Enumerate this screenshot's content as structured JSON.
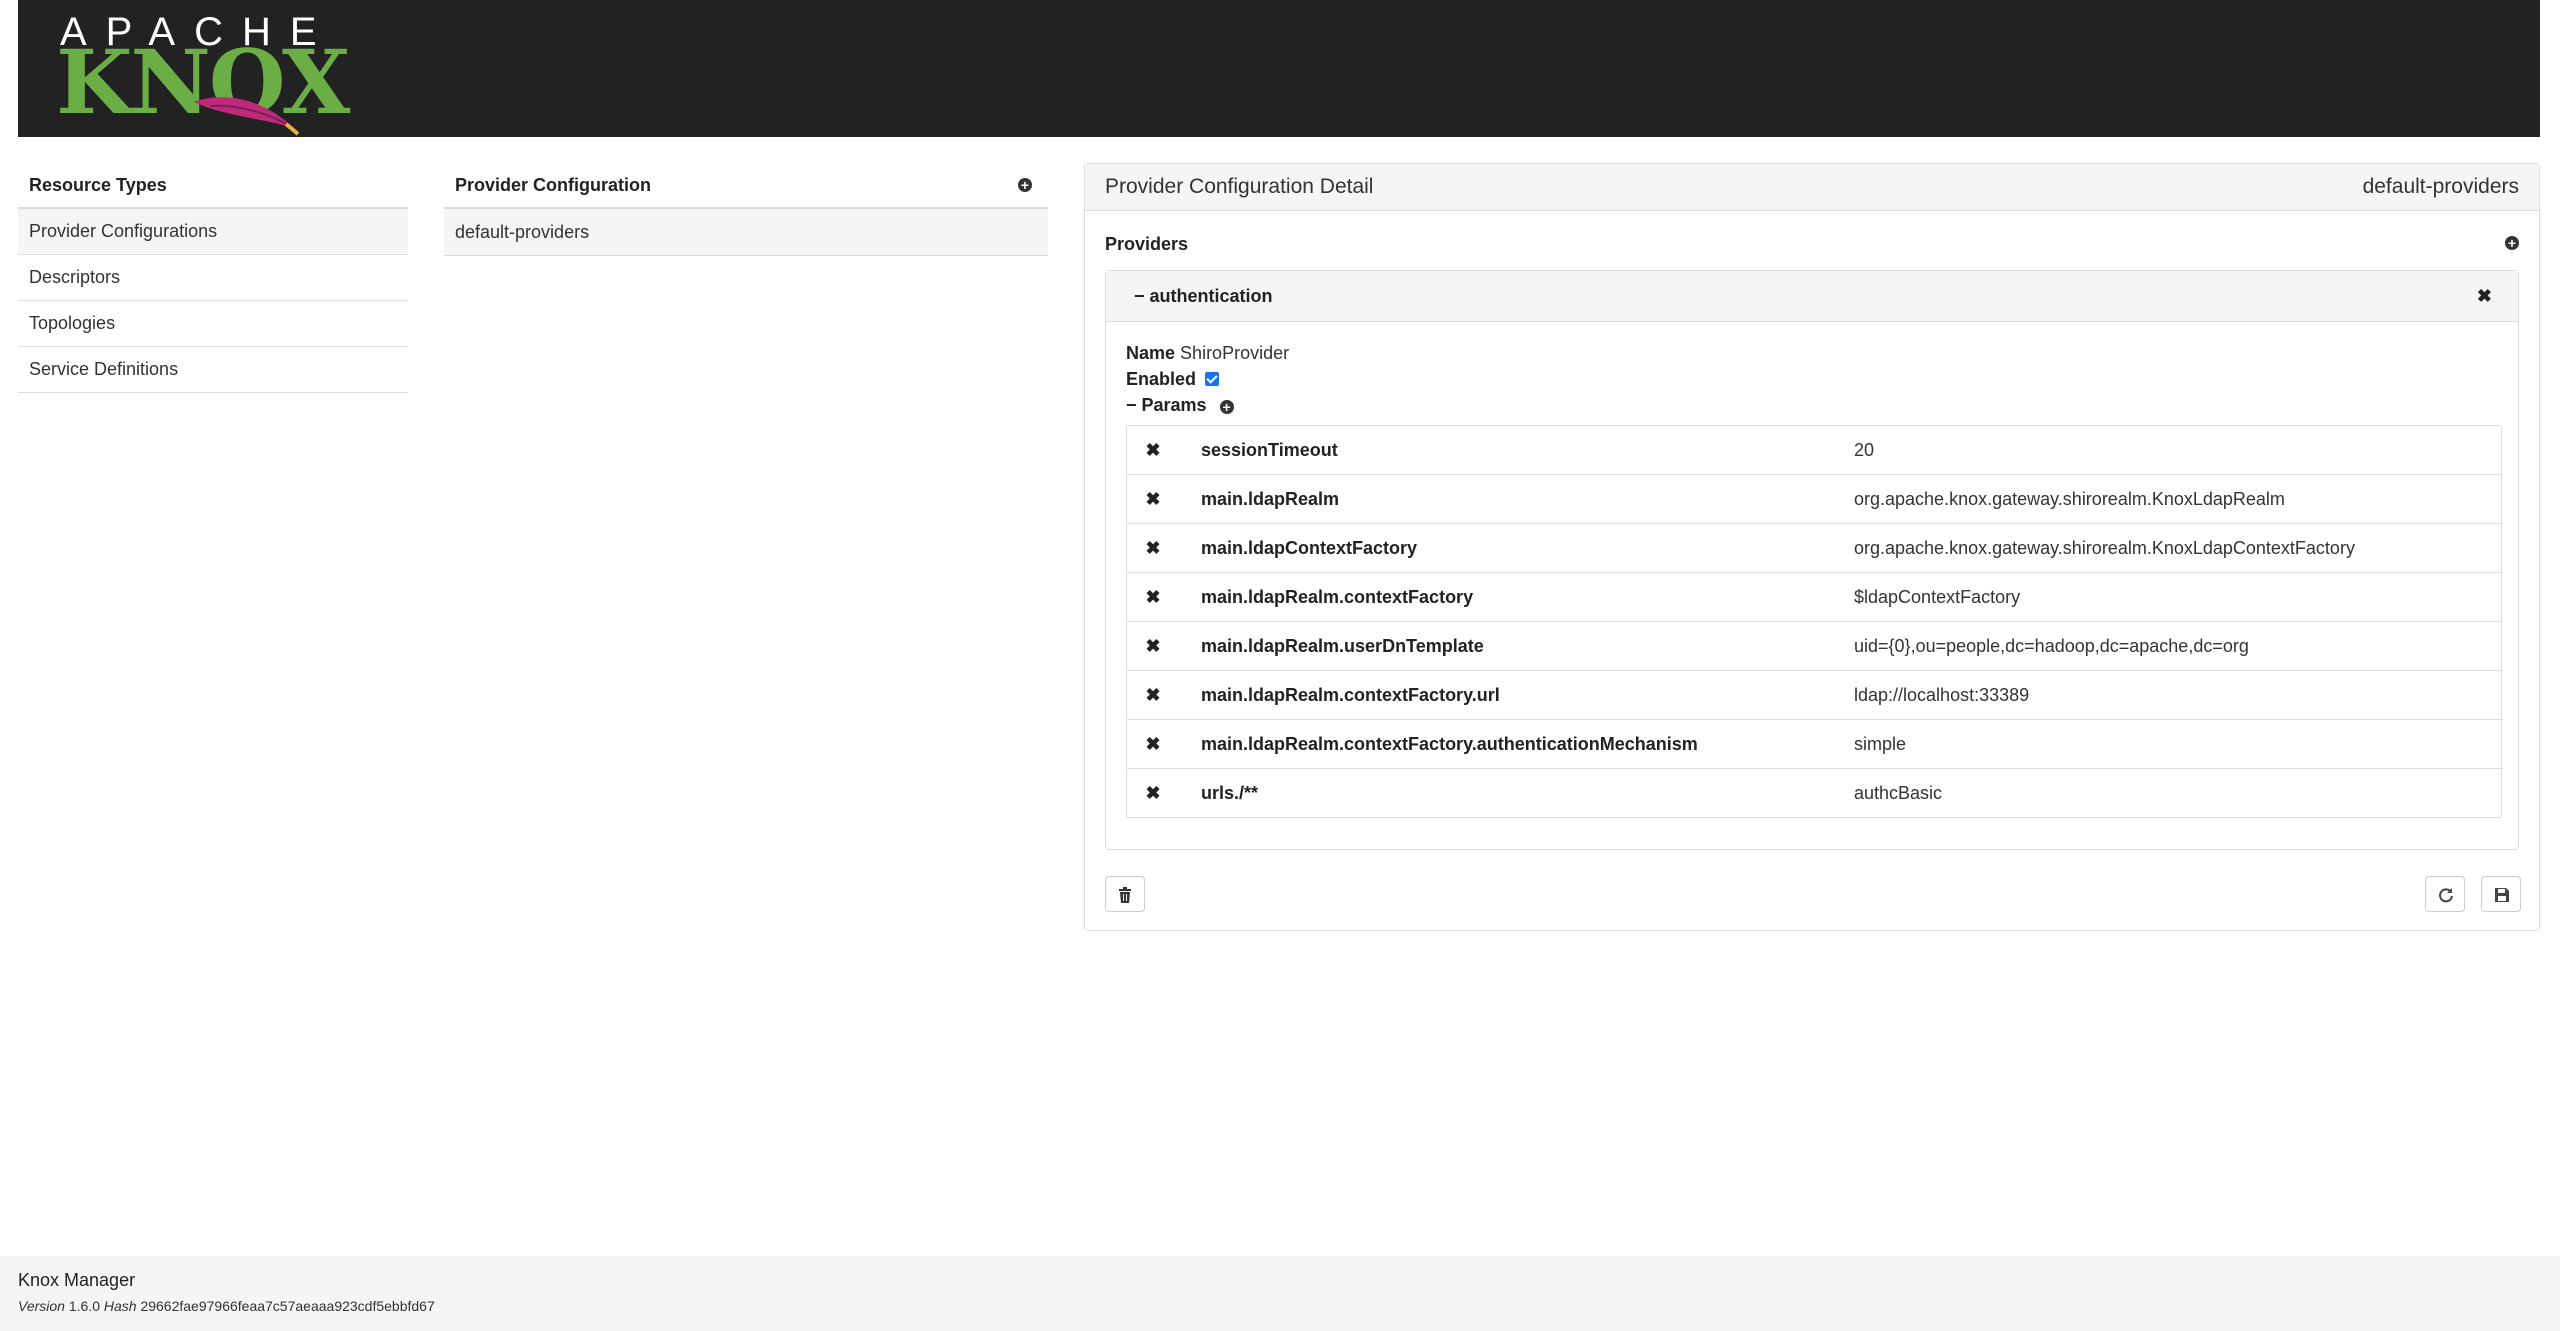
{
  "header": {
    "logo_apache": "APACHE",
    "logo_knox": "KNOX"
  },
  "sidebar": {
    "title": "Resource Types",
    "items": [
      {
        "label": "Provider Configurations",
        "active": true
      },
      {
        "label": "Descriptors"
      },
      {
        "label": "Topologies"
      },
      {
        "label": "Service Definitions"
      }
    ]
  },
  "provider_list": {
    "title": "Provider Configuration",
    "items": [
      "default-providers"
    ]
  },
  "detail": {
    "title": "Provider Configuration Detail",
    "name": "default-providers",
    "providers_label": "Providers",
    "provider": {
      "role": "− authentication",
      "name_label": "Name",
      "name_value": "ShiroProvider",
      "enabled_label": "Enabled",
      "enabled": true,
      "params_label": "− Params",
      "params": [
        {
          "key": "sessionTimeout",
          "value": "20"
        },
        {
          "key": "main.ldapRealm",
          "value": "org.apache.knox.gateway.shirorealm.KnoxLdapRealm"
        },
        {
          "key": "main.ldapContextFactory",
          "value": "org.apache.knox.gateway.shirorealm.KnoxLdapContextFactory"
        },
        {
          "key": "main.ldapRealm.contextFactory",
          "value": "$ldapContextFactory"
        },
        {
          "key": "main.ldapRealm.userDnTemplate",
          "value": "uid={0},ou=people,dc=hadoop,dc=apache,dc=org"
        },
        {
          "key": "main.ldapRealm.contextFactory.url",
          "value": "ldap://localhost:33389"
        },
        {
          "key": "main.ldapRealm.contextFactory.authenticationMechanism",
          "value": "simple"
        },
        {
          "key": "urls./**",
          "value": "authcBasic"
        }
      ]
    }
  },
  "footer": {
    "title": "Knox Manager",
    "version_label": "Version",
    "version": "1.6.0",
    "hash_label": "Hash",
    "hash": "29662fae97966feaa7c57aeaaa923cdf5ebbfd67"
  },
  "icons": {
    "add": "plus-circle-icon",
    "remove": "close-icon",
    "delete": "trash-icon",
    "refresh": "refresh-icon",
    "save": "floppy-disk-icon"
  }
}
